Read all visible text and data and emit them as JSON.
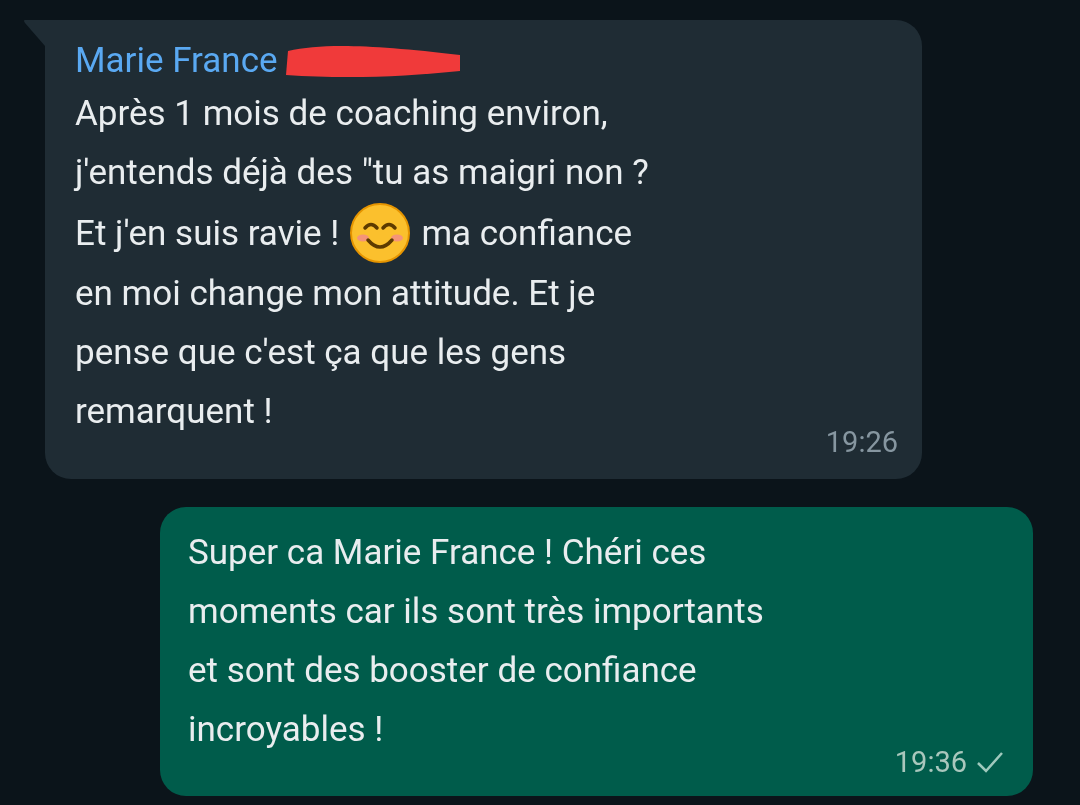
{
  "messages": [
    {
      "kind": "incoming",
      "sender": "Marie France",
      "lines": [
        [
          {
            "kind": "text",
            "text": "Après 1 mois de coaching environ,"
          }
        ],
        [
          {
            "kind": "text",
            "text": "j'entends déjà des \"tu as maigri non ?"
          }
        ],
        [
          {
            "kind": "text",
            "text": "Et j'en suis ravie !"
          },
          {
            "kind": "emoji"
          },
          {
            "kind": "text",
            "text": "ma confiance"
          }
        ],
        [
          {
            "kind": "text",
            "text": "en moi change mon attitude. Et je"
          }
        ],
        [
          {
            "kind": "text",
            "text": "pense que c'est ça que les gens"
          }
        ],
        [
          {
            "kind": "text",
            "text": "remarquent !"
          }
        ]
      ],
      "time": "19:26"
    },
    {
      "kind": "outgoing",
      "lines": [
        [
          {
            "kind": "text",
            "text": "Super ca Marie France ! Chéri ces"
          }
        ],
        [
          {
            "kind": "text",
            "text": "moments car ils sont très importants"
          }
        ],
        [
          {
            "kind": "text",
            "text": "et sont des booster de confiance"
          }
        ],
        [
          {
            "kind": "text",
            "text": "incroyables !"
          }
        ]
      ],
      "time": "19:36",
      "delivered": false
    }
  ]
}
